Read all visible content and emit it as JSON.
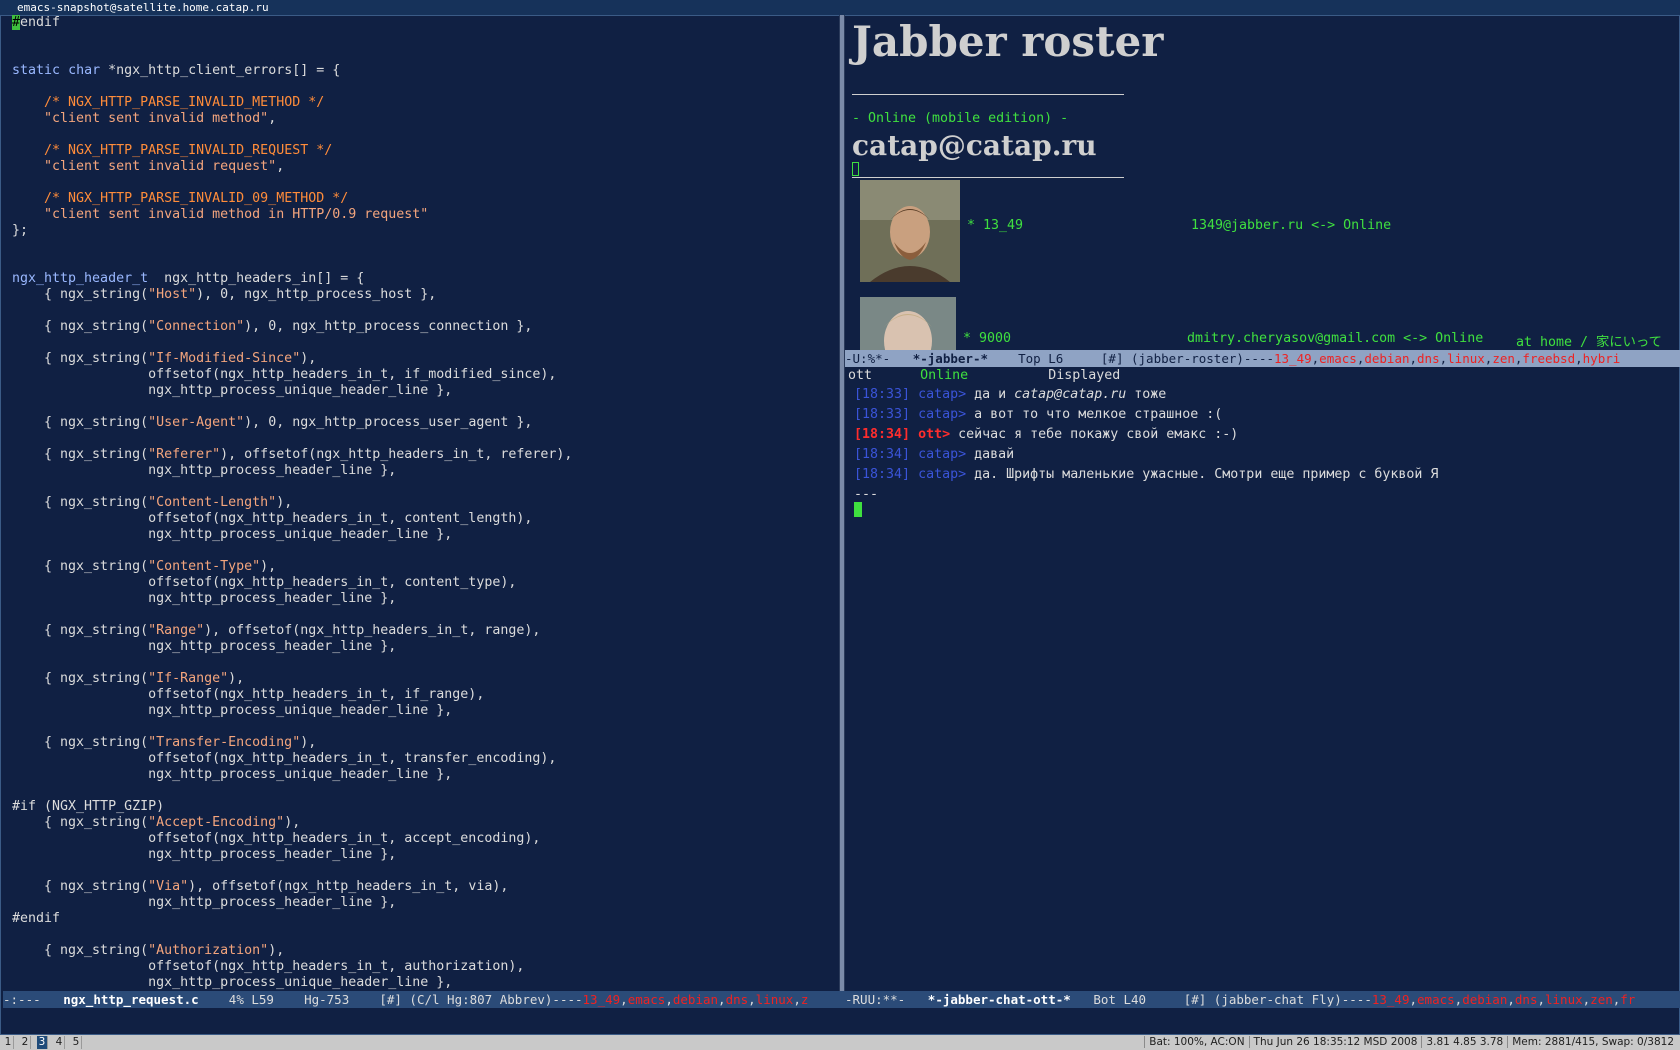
{
  "window": {
    "title": "emacs-snapshot@satellite.home.catap.ru"
  },
  "code_lines": [
    [
      [
        "pp",
        "#"
      ],
      [
        "pp",
        "endif"
      ]
    ],
    [],
    [],
    [
      [
        "kw",
        "static"
      ],
      [
        "pp",
        " "
      ],
      [
        "ty",
        "char"
      ],
      [
        "pp",
        " *ngx_http_client_errors[] = {"
      ]
    ],
    [],
    [
      [
        "pp",
        "    "
      ],
      [
        "cm",
        "/* NGX_HTTP_PARSE_INVALID_METHOD */"
      ]
    ],
    [
      [
        "pp",
        "    "
      ],
      [
        "str",
        "\"client sent invalid method\""
      ],
      [
        "pp",
        ","
      ]
    ],
    [],
    [
      [
        "pp",
        "    "
      ],
      [
        "cm",
        "/* NGX_HTTP_PARSE_INVALID_REQUEST */"
      ]
    ],
    [
      [
        "pp",
        "    "
      ],
      [
        "str",
        "\"client sent invalid request\""
      ],
      [
        "pp",
        ","
      ]
    ],
    [],
    [
      [
        "pp",
        "    "
      ],
      [
        "cm",
        "/* NGX_HTTP_PARSE_INVALID_09_METHOD */"
      ]
    ],
    [
      [
        "pp",
        "    "
      ],
      [
        "str",
        "\"client sent invalid method in HTTP/0.9 request\""
      ]
    ],
    [
      [
        "pp",
        "};"
      ]
    ],
    [],
    [],
    [
      [
        "ty",
        "ngx_http_header_t"
      ],
      [
        "pp",
        "  ngx_http_headers_in[] = {"
      ]
    ],
    [
      [
        "pp",
        "    { ngx_string("
      ],
      [
        "str",
        "\"Host\""
      ],
      [
        "pp",
        "), 0, ngx_http_process_host },"
      ]
    ],
    [],
    [
      [
        "pp",
        "    { ngx_string("
      ],
      [
        "str",
        "\"Connection\""
      ],
      [
        "pp",
        "), 0, ngx_http_process_connection },"
      ]
    ],
    [],
    [
      [
        "pp",
        "    { ngx_string("
      ],
      [
        "str",
        "\"If-Modified-Since\""
      ],
      [
        "pp",
        "),"
      ]
    ],
    [
      [
        "pp",
        "                 offsetof(ngx_http_headers_in_t, if_modified_since),"
      ]
    ],
    [
      [
        "pp",
        "                 ngx_http_process_unique_header_line },"
      ]
    ],
    [],
    [
      [
        "pp",
        "    { ngx_string("
      ],
      [
        "str",
        "\"User-Agent\""
      ],
      [
        "pp",
        "), 0, ngx_http_process_user_agent },"
      ]
    ],
    [],
    [
      [
        "pp",
        "    { ngx_string("
      ],
      [
        "str",
        "\"Referer\""
      ],
      [
        "pp",
        "), offsetof(ngx_http_headers_in_t, referer),"
      ]
    ],
    [
      [
        "pp",
        "                 ngx_http_process_header_line },"
      ]
    ],
    [],
    [
      [
        "pp",
        "    { ngx_string("
      ],
      [
        "str",
        "\"Content-Length\""
      ],
      [
        "pp",
        "),"
      ]
    ],
    [
      [
        "pp",
        "                 offsetof(ngx_http_headers_in_t, content_length),"
      ]
    ],
    [
      [
        "pp",
        "                 ngx_http_process_unique_header_line },"
      ]
    ],
    [],
    [
      [
        "pp",
        "    { ngx_string("
      ],
      [
        "str",
        "\"Content-Type\""
      ],
      [
        "pp",
        "),"
      ]
    ],
    [
      [
        "pp",
        "                 offsetof(ngx_http_headers_in_t, content_type),"
      ]
    ],
    [
      [
        "pp",
        "                 ngx_http_process_header_line },"
      ]
    ],
    [],
    [
      [
        "pp",
        "    { ngx_string("
      ],
      [
        "str",
        "\"Range\""
      ],
      [
        "pp",
        "), offsetof(ngx_http_headers_in_t, range),"
      ]
    ],
    [
      [
        "pp",
        "                 ngx_http_process_header_line },"
      ]
    ],
    [],
    [
      [
        "pp",
        "    { ngx_string("
      ],
      [
        "str",
        "\"If-Range\""
      ],
      [
        "pp",
        "),"
      ]
    ],
    [
      [
        "pp",
        "                 offsetof(ngx_http_headers_in_t, if_range),"
      ]
    ],
    [
      [
        "pp",
        "                 ngx_http_process_unique_header_line },"
      ]
    ],
    [],
    [
      [
        "pp",
        "    { ngx_string("
      ],
      [
        "str",
        "\"Transfer-Encoding\""
      ],
      [
        "pp",
        "),"
      ]
    ],
    [
      [
        "pp",
        "                 offsetof(ngx_http_headers_in_t, transfer_encoding),"
      ]
    ],
    [
      [
        "pp",
        "                 ngx_http_process_unique_header_line },"
      ]
    ],
    [],
    [
      [
        "pp",
        "#if (NGX_HTTP_GZIP)"
      ]
    ],
    [
      [
        "pp",
        "    { ngx_string("
      ],
      [
        "str",
        "\"Accept-Encoding\""
      ],
      [
        "pp",
        "),"
      ]
    ],
    [
      [
        "pp",
        "                 offsetof(ngx_http_headers_in_t, accept_encoding),"
      ]
    ],
    [
      [
        "pp",
        "                 ngx_http_process_header_line },"
      ]
    ],
    [],
    [
      [
        "pp",
        "    { ngx_string("
      ],
      [
        "str",
        "\"Via\""
      ],
      [
        "pp",
        "), offsetof(ngx_http_headers_in_t, via),"
      ]
    ],
    [
      [
        "pp",
        "                 ngx_http_process_header_line },"
      ]
    ],
    [
      [
        "pp",
        "#endif"
      ]
    ],
    [],
    [
      [
        "pp",
        "    { ngx_string("
      ],
      [
        "str",
        "\"Authorization\""
      ],
      [
        "pp",
        "),"
      ]
    ],
    [
      [
        "pp",
        "                 offsetof(ngx_http_headers_in_t, authorization),"
      ]
    ],
    [
      [
        "pp",
        "                 ngx_http_process_unique_header_line },"
      ]
    ]
  ],
  "roster": {
    "title": "Jabber roster",
    "status": " - Online (mobile edition) -",
    "jid": "catap@catap.ru",
    "contacts": [
      {
        "name": "* 13_49",
        "jid": "1349@jabber.ru <-> Online",
        "extra": ""
      },
      {
        "name": "* 9000",
        "jid": "dmitry.cheryasov@gmail.com <-> Online",
        "extra": "at home / 家にいって"
      }
    ]
  },
  "roster_modeline": {
    "flags": "-U:%*-",
    "buffer": "*-jabber-*",
    "pos": "Top L6",
    "mode": "[#] (jabber-roster)----",
    "tags": [
      "13_49",
      "emacs",
      "debian",
      "dns",
      "linux",
      "zen",
      "freebsd",
      "hybri"
    ]
  },
  "chat_header": {
    "name": "ott",
    "status": "Online",
    "extra": "Displayed"
  },
  "chat_messages": [
    {
      "time": "[18:33]",
      "nick": "catap>",
      "text": "да и ",
      "italic": "catap@catap.ru",
      "rest": " тоже",
      "remote": false
    },
    {
      "time": "[18:33]",
      "nick": "catap>",
      "text": "а вот то что мелкое страшное :(",
      "italic": "",
      "rest": "",
      "remote": false
    },
    {
      "time": "[18:34]",
      "nick": "ott>",
      "text": "сейчас я тебе покажу свой емакс :-)",
      "italic": "",
      "rest": "",
      "remote": true
    },
    {
      "time": "[18:34]",
      "nick": "catap>",
      "text": "давай",
      "italic": "",
      "rest": "",
      "remote": false
    },
    {
      "time": "[18:34]",
      "nick": "catap>",
      "text": "да. Шрифты маленькие ужасные. Смотри еще пример с буквой Я",
      "italic": "",
      "rest": "",
      "remote": false
    }
  ],
  "chat_separator": "---",
  "left_modeline": {
    "flags": "-:---",
    "buffer": "ngx_http_request.c",
    "pos": "4% L59",
    "vc": "Hg-753",
    "mode": "[#] (C/l Hg:807 Abbrev)----",
    "tags": [
      "13_49",
      "emacs",
      "debian",
      "dns",
      "linux",
      "z"
    ]
  },
  "right_modeline": {
    "flags": "-RUU:**-",
    "buffer": "*-jabber-chat-ott-*",
    "pos": "Bot L40",
    "mode": "[#] (jabber-chat Fly)----",
    "tags": [
      "13_49",
      "emacs",
      "debian",
      "dns",
      "linux",
      "zen",
      "fr"
    ]
  },
  "workspaces": [
    {
      "label": "1",
      "active": false
    },
    {
      "label": "2",
      "active": false
    },
    {
      "label": "3",
      "active": true
    },
    {
      "label": "4",
      "active": false
    },
    {
      "label": "5",
      "active": false
    }
  ],
  "system": {
    "battery": "Bat: 100%, AC:ON",
    "clock": "Thu Jun 26 18:35:12 MSD 2008",
    "load": "3.81 4.85 3.78",
    "mem": "Mem: 2881/415, Swap: 0/3812"
  },
  "colors": {
    "background": "#102043",
    "green": "#3fe03f",
    "tag_red": "#ff2d2d",
    "nick_blue": "#3a54d8"
  }
}
